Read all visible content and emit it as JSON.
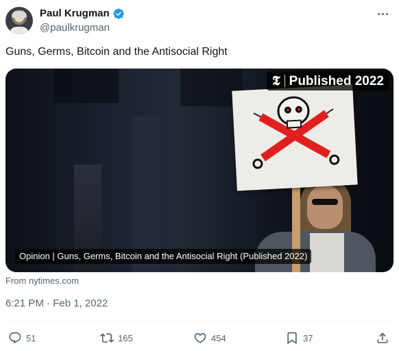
{
  "author": {
    "display_name": "Paul Krugman",
    "handle": "@paulkrugman",
    "verified_color": "#1d9bf0"
  },
  "tweet": {
    "text": "Guns, Germs, Bitcoin and the Antisocial Right",
    "timestamp": "6:21 PM · Feb 1, 2022"
  },
  "card": {
    "badge_logo": "𝕿",
    "badge_text": "Published 2022",
    "caption": "Opinion | Guns, Germs, Bitcoin and the Antisocial Right (Published 2022)",
    "source": "From nytimes.com"
  },
  "actions": {
    "replies": "51",
    "retweets": "165",
    "likes": "454",
    "bookmarks": "37"
  },
  "icons": [
    "more-icon",
    "verified-icon",
    "reply-icon",
    "retweet-icon",
    "like-icon",
    "bookmark-icon",
    "share-icon"
  ]
}
